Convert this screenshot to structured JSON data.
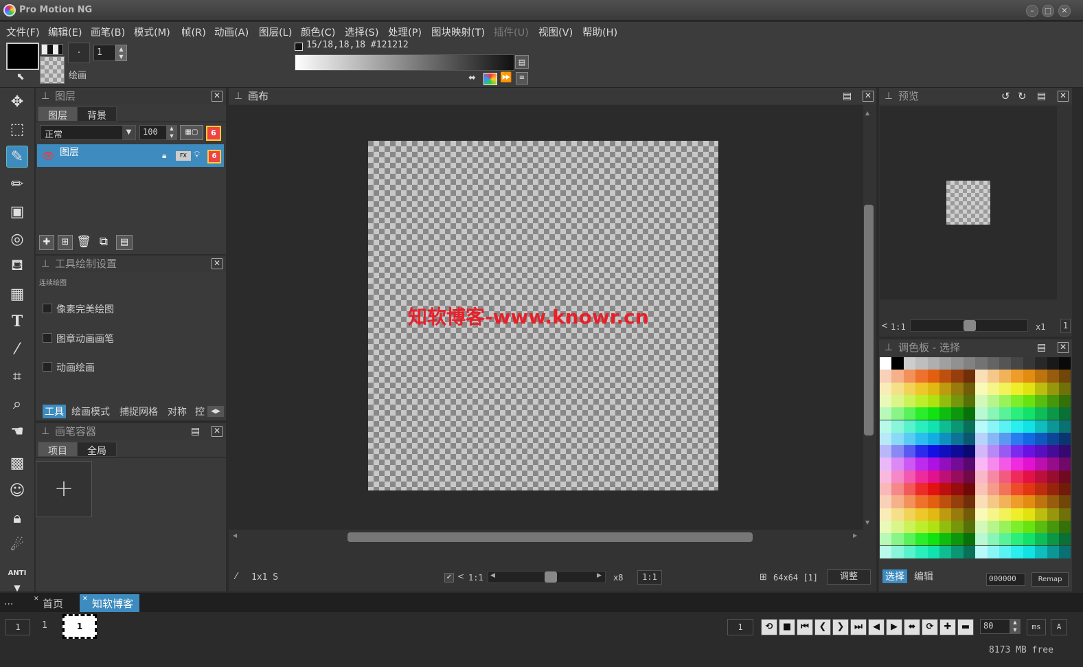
{
  "window": {
    "title": "Pro Motion NG"
  },
  "menu": [
    "文件(F)",
    "编辑(E)",
    "画笔(B)",
    "模式(M)",
    "帧(R)",
    "动画(A)",
    "图层(L)",
    "颜色(C)",
    "选择(S)",
    "处理(P)",
    "图块映射(T)",
    "插件(U)",
    "视图(V)",
    "帮助(H)"
  ],
  "toolbar": {
    "brush_size": "·",
    "spin_value": "1",
    "mode_label": "绘画",
    "color_info": "15/18,18,18 #121212"
  },
  "layers_panel": {
    "title": "图层",
    "tabs": [
      "图层",
      "背景"
    ],
    "blend_mode": "正常",
    "opacity": "100",
    "layer_name": "图层"
  },
  "tool_settings": {
    "title": "工具绘制设置",
    "section": "连续绘图",
    "options": [
      "像素完美绘图",
      "图章动画画笔",
      "动画绘画"
    ],
    "tabs": [
      "工具",
      "绘画模式",
      "捕捉网格",
      "对称",
      "控"
    ]
  },
  "brush_container": {
    "title": "画笔容器",
    "tabs": [
      "项目",
      "全局"
    ],
    "add": "+"
  },
  "canvas_panel": {
    "title": "画布",
    "watermark": "知软博客-www.knowr.cn",
    "brush_info": "1x1 S",
    "zoom_ratio": "1:1",
    "zoom_factor": "x8",
    "zoom_btn": "1:1",
    "size_info": "64x64 [1]",
    "adjust_btn": "调整"
  },
  "preview_panel": {
    "title": "预览",
    "zoom_ratio": "1:1",
    "zoom_factor": "x1",
    "frame": "1"
  },
  "palette_panel": {
    "title": "调色板 - 选择",
    "tab_select": "选择",
    "tab_edit": "编辑",
    "hex_value": "000000",
    "remap_btn": "Remap"
  },
  "doc_tabs": [
    {
      "label": "首页",
      "active": false
    },
    {
      "label": "知软博客",
      "active": true
    }
  ],
  "dots": "...",
  "timeline": {
    "left_field": "1",
    "frame_num": "1",
    "frame_thumb": "1",
    "right_field": "1",
    "speed": "80",
    "unit": "ms",
    "a_btn": "A"
  },
  "status": {
    "memory": "8173 MB free"
  },
  "colors": {
    "bg": "#2b2b2b",
    "panel": "#3a3a3a",
    "selected_layer": "#3d8bbf",
    "accent_tab": "#3d8bbf",
    "watermark": "#e8202a"
  }
}
